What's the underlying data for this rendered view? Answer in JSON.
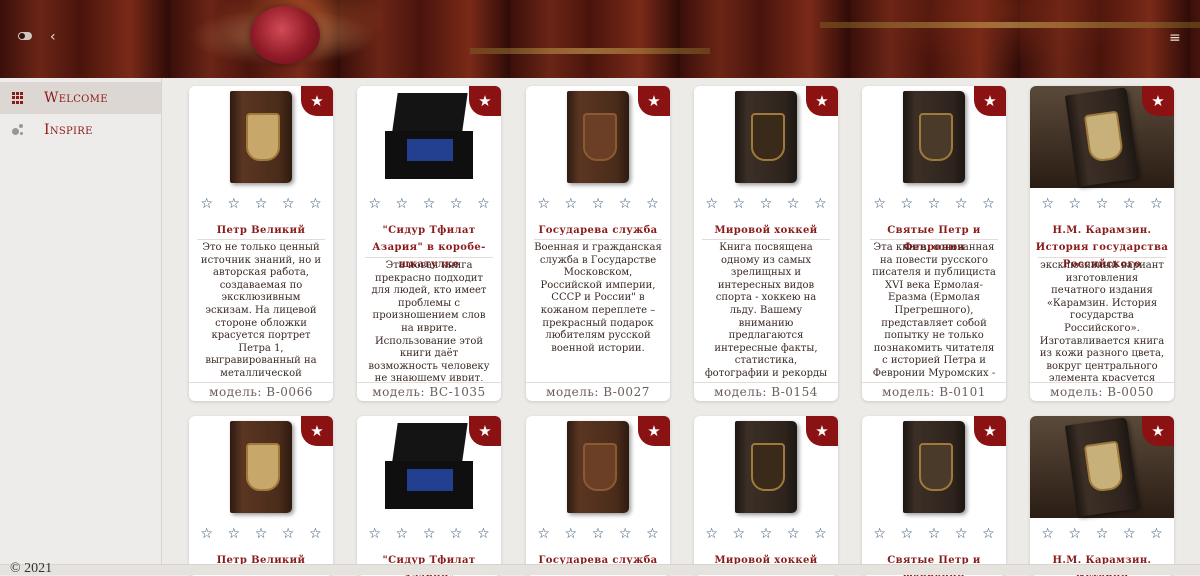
{
  "header": {
    "toggle_icon": "toggle-icon",
    "back_icon": "chevron-left-icon",
    "menu_icon": "hamburger-menu-icon"
  },
  "sidebar": {
    "items": [
      {
        "label": "Welcome",
        "icon": "grid-icon",
        "active": true
      },
      {
        "label": "Inspire",
        "icon": "bubbles-icon",
        "active": false
      }
    ]
  },
  "products": [
    {
      "title": "Петр Великий",
      "description": "Это не только ценный источник знаний, но и авторская работа, создаваемая по эксклюзивным эскизам. На лицевой стороне обложки красуется портрет Петра 1, выгравированный на металлической вставке.",
      "model": "модель:  B-0066",
      "image": "book-brown"
    },
    {
      "title": "\"Сидур Тфилат Азария\" в коробе-шкатулке",
      "description": "Эта новая книга прекрасно подходит для людей, кто имеет проблемы с произношением слов на иврите. Использование этой книги даёт возможность человеку не знающему иврит,",
      "model": "модель:  BC-1035",
      "image": "box-set"
    },
    {
      "title": "Государева служба",
      "description": "Военная и гражданская служба в Государстве Московском, Российской империи, СССР и России\" в кожаном переплете – прекрасный подарок любителям русской военной истории.",
      "model": "модель:  B-0027",
      "image": "book-brown"
    },
    {
      "title": "Мировой хоккей",
      "description": "Книга посвящена одному из самых зрелищных и интересных видов спорта - хоккею на льду. Вашему вниманию предлагаются интересные факты, статистика, фотографии и рекорды",
      "model": "модель:  B-0154",
      "image": "book-dark"
    },
    {
      "title": "Святые Петр и Феврония",
      "description": "Эта книга, основанная на повести русского писателя и публициста XVI века Ермолая-Еразма (Ермолая Прегрешного), представляет собой попытку не только познакомить читателя с историей Петра и Февронии Муромских -",
      "model": "модель:  B-0101",
      "image": "book-dark"
    },
    {
      "title": "Н.М. Карамзин. История государства Российского",
      "description": "эксклюзивный вариант изготовления печатного издания «Карамзин. История государства Российского». Изготавливается книга из кожи разного цвета, вокруг центрального элемента красуется",
      "model": "модель:  B-0050",
      "image": "book-photo"
    }
  ],
  "second_row_titles": [
    "Петр Великий",
    "\"Сидур Тфилат Азария\"",
    "Государева служба",
    "Мировой хоккей",
    "Святые Петр и Феврония",
    "Н.М. Карамзин. История"
  ],
  "card_ui": {
    "favorite_icon": "star-plus-icon",
    "rating_icon": "star-outline-icon",
    "rating": 0,
    "rating_max": 5
  },
  "footer": {
    "copyright": "© 2021"
  },
  "colors": {
    "accent": "#8b1a1a",
    "favorite_bg": "#8b1212",
    "star": "#2e4a6a",
    "page_bg": "#ecebe8"
  }
}
